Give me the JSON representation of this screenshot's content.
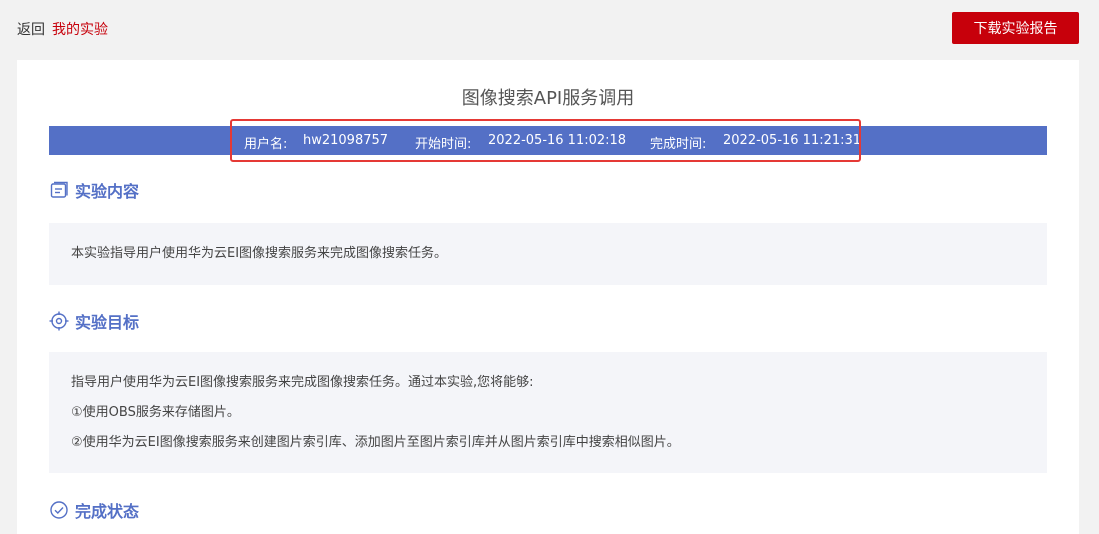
{
  "header": {
    "back_label": "返回",
    "crumb_label": "我的实验",
    "download_label": "下载实验报告"
  },
  "report": {
    "title": "图像搜索API服务调用",
    "user_label": "用户名:",
    "user_value": "hw21098757",
    "start_label": "开始时间:",
    "start_value": "2022-05-16 11:02:18",
    "finish_label": "完成时间:",
    "finish_value": "2022-05-16 11:21:31"
  },
  "sections": {
    "content": {
      "heading": "实验内容",
      "icon": "document-icon",
      "text": "本实验指导用户使用华为云EI图像搜索服务来完成图像搜索任务。"
    },
    "goal": {
      "heading": "实验目标",
      "icon": "target-icon",
      "lines": [
        "指导用户使用华为云EI图像搜索服务来完成图像搜索任务。通过本实验,您将能够:",
        "①使用OBS服务来存储图片。",
        "②使用华为云EI图像搜索服务来创建图片索引库、添加图片至图片索引库并从图片索引库中搜索相似图片。"
      ]
    },
    "status": {
      "heading": "完成状态",
      "icon": "check-circle-icon"
    }
  },
  "colors": {
    "brand_red": "#c7000b",
    "accent_blue": "#5470c6",
    "highlight_red": "#e53935"
  }
}
